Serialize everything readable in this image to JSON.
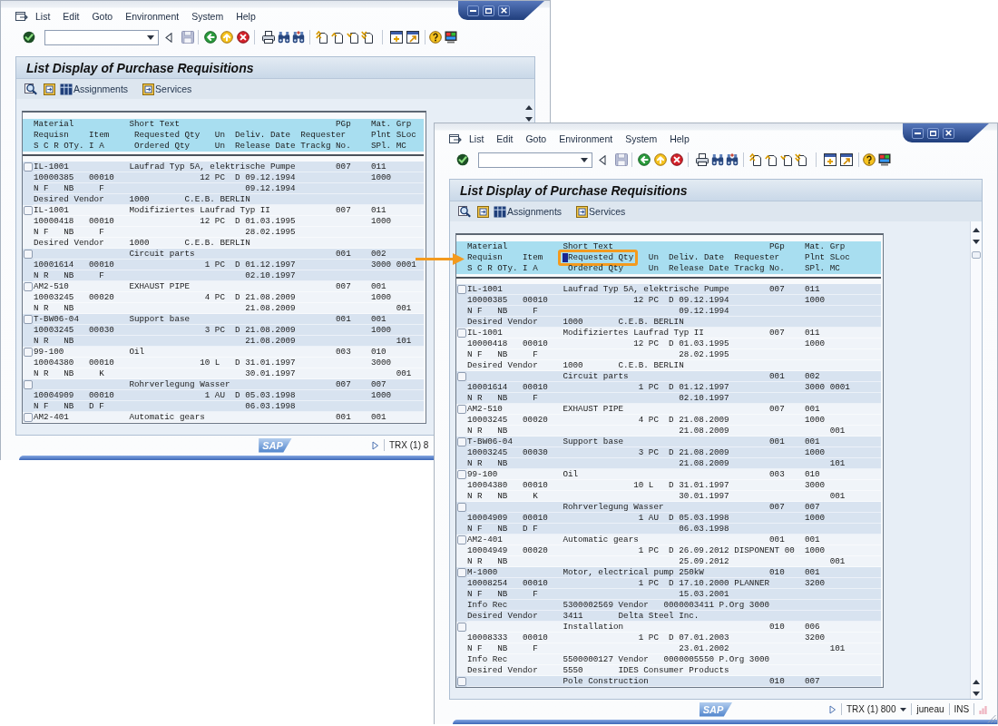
{
  "windows": [
    {
      "menu": [
        "List",
        "Edit",
        "Goto",
        "Environment",
        "System",
        "Help"
      ],
      "toolbar": {
        "save": {
          "disabled": true
        }
      },
      "title": "List Display of Purchase Requisitions",
      "app_toolbar": [
        {
          "kind": "assignments",
          "label": "Assignments"
        },
        {
          "kind": "services",
          "label": "Services"
        }
      ],
      "list": {
        "header": [
          [
            {
              "text": "Material           Short Text                               PGp    Mat. Grp",
              "highlighted": false,
              "cursor": false
            }
          ],
          [
            {
              "text": "Requisn    Item     Requested Qty   Un  Deliv. Date  Requester     Plnt SLoc",
              "highlighted": false,
              "cursor": false
            }
          ],
          [
            {
              "text": "S C R OTy. I A      Ordered Qty     Un  Release Date Trackg No.    SPl. MC",
              "highlighted": false,
              "cursor": false
            }
          ]
        ],
        "items": [
          {
            "checked": false,
            "lines": [
              "IL-1001            Laufrad Typ 5A, elektrische Pumpe        007    011",
              "10000385   00010                 12 PC  D 09.12.1994               1000",
              "N F   NB     F                            09.12.1994",
              "Desired Vendor     1000       C.E.B. BERLIN"
            ]
          },
          {
            "checked": false,
            "lines": [
              "IL-1001            Modifiziertes Laufrad Typ II             007    011",
              "10000418   00010                 12 PC  D 01.03.1995               1000",
              "N F   NB     F                            28.02.1995",
              "Desired Vendor     1000       C.E.B. BERLIN"
            ]
          },
          {
            "checked": false,
            "lines": [
              "                   Circuit parts                            001    002",
              "10001614   00010                  1 PC  D 01.12.1997               3000 0001",
              "N R   NB     F                            02.10.1997"
            ]
          },
          {
            "checked": false,
            "lines": [
              "AM2-510            EXHAUST PIPE                             007    001",
              "10003245   00020                  4 PC  D 21.08.2009               1000",
              "N R   NB                                  21.08.2009                    001"
            ]
          },
          {
            "checked": false,
            "lines": [
              "T-BW06-04          Support base                             001    001",
              "10003245   00030                  3 PC  D 21.08.2009               1000",
              "N R   NB                                  21.08.2009                    101"
            ]
          },
          {
            "checked": false,
            "lines": [
              "99-100             Oil                                      003    010",
              "10004380   00010                 10 L   D 31.01.1997               3000",
              "N R   NB     K                            30.01.1997                    001"
            ]
          },
          {
            "checked": false,
            "lines": [
              "                   Rohrverlegung Wasser                     007    007",
              "10004909   00010                  1 AU  D 05.03.1998               1000",
              "N F   NB   D F                            06.03.1998"
            ]
          },
          {
            "checked": false,
            "lines": [
              "AM2-401            Automatic gears                          001    001"
            ]
          }
        ]
      },
      "status_bar": {
        "logo": "SAP",
        "session": "TRX (1) 8"
      }
    },
    {
      "menu": [
        "List",
        "Edit",
        "Goto",
        "Environment",
        "System",
        "Help"
      ],
      "toolbar": {
        "save": {
          "disabled": true
        }
      },
      "title": "List Display of Purchase Requisitions",
      "app_toolbar": [
        {
          "kind": "assignments",
          "label": "Assignments"
        },
        {
          "kind": "services",
          "label": "Services"
        }
      ],
      "list": {
        "header": [
          [
            {
              "text": "Material           Short Text                               PGp    Mat. Grp",
              "highlighted": false,
              "cursor": false
            }
          ],
          [
            {
              "text": "Requisn    Item    ",
              "highlighted": false,
              "cursor": false
            },
            {
              "text": "Requested Qty",
              "highlighted": true,
              "cursor": true
            },
            {
              "text": "   Un  Deliv. Date  Requester     Plnt SLoc",
              "highlighted": false,
              "cursor": false
            }
          ],
          [
            {
              "text": "S C R OTy. I A      Ordered Qty     Un  Release Date Trackg No.    SPl. MC",
              "highlighted": false,
              "cursor": false
            }
          ]
        ],
        "items": [
          {
            "checked": false,
            "lines": [
              "IL-1001            Laufrad Typ 5A, elektrische Pumpe        007    011",
              "10000385   00010                 12 PC  D 09.12.1994               1000",
              "N F   NB     F                            09.12.1994",
              "Desired Vendor     1000       C.E.B. BERLIN"
            ]
          },
          {
            "checked": false,
            "lines": [
              "IL-1001            Modifiziertes Laufrad Typ II             007    011",
              "10000418   00010                 12 PC  D 01.03.1995               1000",
              "N F   NB     F                            28.02.1995",
              "Desired Vendor     1000       C.E.B. BERLIN"
            ]
          },
          {
            "checked": false,
            "lines": [
              "                   Circuit parts                            001    002",
              "10001614   00010                  1 PC  D 01.12.1997               3000 0001",
              "N R   NB     F                            02.10.1997"
            ]
          },
          {
            "checked": false,
            "lines": [
              "AM2-510            EXHAUST PIPE                             007    001",
              "10003245   00020                  4 PC  D 21.08.2009               1000",
              "N R   NB                                  21.08.2009                    001"
            ]
          },
          {
            "checked": false,
            "lines": [
              "T-BW06-04          Support base                             001    001",
              "10003245   00030                  3 PC  D 21.08.2009               1000",
              "N R   NB                                  21.08.2009                    101"
            ]
          },
          {
            "checked": false,
            "lines": [
              "99-100             Oil                                      003    010",
              "10004380   00010                 10 L   D 31.01.1997               3000",
              "N R   NB     K                            30.01.1997                    001"
            ]
          },
          {
            "checked": false,
            "lines": [
              "                   Rohrverlegung Wasser                     007    007",
              "10004909   00010                  1 AU  D 05.03.1998               1000",
              "N F   NB   D F                            06.03.1998"
            ]
          },
          {
            "checked": false,
            "lines": [
              "AM2-401            Automatic gears                          001    001",
              "10004949   00020                  1 PC  D 26.09.2012 DISPONENT 00  1000",
              "N R   NB                                  25.09.2012                    001"
            ]
          },
          {
            "checked": false,
            "lines": [
              "M-1000             Motor, electrical pump 250kW             010    001",
              "10008254   00010                  1 PC  D 17.10.2000 PLANNER       3200",
              "N F   NB     F                            15.03.2001",
              "Info Rec           5300002569 Vendor   0000003411 P.Org 3000",
              "Desired Vendor     3411       Delta Steel Inc."
            ]
          },
          {
            "checked": false,
            "lines": [
              "                   Installation                             010    006",
              "10008333   00010                  1 PC  D 07.01.2003               3200",
              "N F   NB     F                            23.01.2002                    101",
              "Info Rec           5500000127 Vendor   0000005550 P.Org 3000",
              "Desired Vendor     5550       IDES Consumer Products"
            ]
          },
          {
            "checked": false,
            "lines": [
              "                   Pole Construction                        010    007"
            ]
          }
        ]
      },
      "status_bar": {
        "logo": "SAP",
        "session": "TRX (1) 800",
        "server": "juneau",
        "mode": "INS"
      }
    }
  ]
}
